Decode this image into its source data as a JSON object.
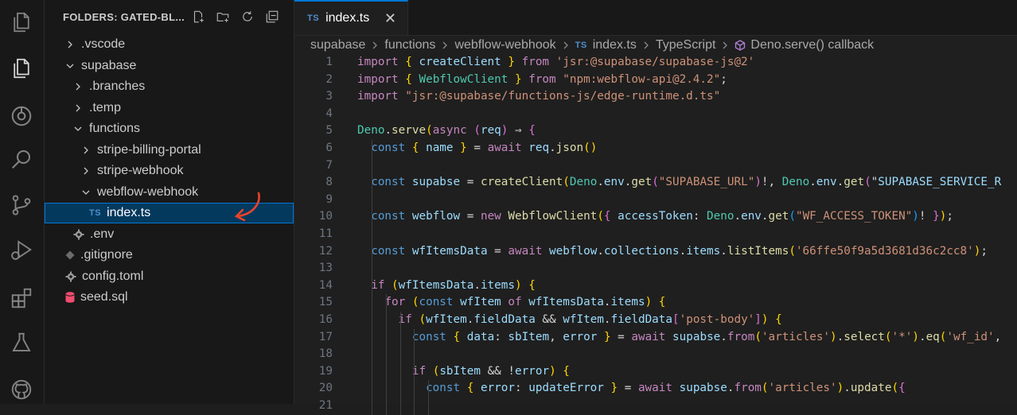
{
  "activity_bar": {
    "icons": [
      "explorer-files-icon",
      "explorer-active-icon",
      "remote-icon",
      "search-icon",
      "source-control-icon",
      "run-debug-icon",
      "extensions-icon",
      "testing-icon",
      "github-icon"
    ]
  },
  "sidebar": {
    "title": "FOLDERS: GATED-BL...",
    "tools": [
      "new-file-icon",
      "new-folder-icon",
      "refresh-icon",
      "collapse-icon"
    ],
    "tree": [
      {
        "label": ".vscode",
        "type": "folder",
        "expanded": false,
        "depth": 0
      },
      {
        "label": "supabase",
        "type": "folder",
        "expanded": true,
        "depth": 0
      },
      {
        "label": ".branches",
        "type": "folder",
        "expanded": false,
        "depth": 1
      },
      {
        "label": ".temp",
        "type": "folder",
        "expanded": false,
        "depth": 1
      },
      {
        "label": "functions",
        "type": "folder",
        "expanded": true,
        "depth": 1
      },
      {
        "label": "stripe-billing-portal",
        "type": "folder",
        "expanded": false,
        "depth": 2
      },
      {
        "label": "stripe-webhook",
        "type": "folder",
        "expanded": false,
        "depth": 2
      },
      {
        "label": "webflow-webhook",
        "type": "folder",
        "expanded": true,
        "depth": 2
      },
      {
        "label": "index.ts",
        "type": "ts",
        "depth": 3,
        "selected": true
      },
      {
        "label": ".env",
        "type": "env",
        "depth": 1
      },
      {
        "label": ".gitignore",
        "type": "git",
        "depth": 0
      },
      {
        "label": "config.toml",
        "type": "gear",
        "depth": 0
      },
      {
        "label": "seed.sql",
        "type": "db",
        "depth": 0
      }
    ]
  },
  "editor": {
    "tab": {
      "badge": "TS",
      "label": "index.ts",
      "close": "✕"
    },
    "breadcrumb": [
      "supabase",
      "functions",
      "webflow-webhook",
      "index.ts",
      "TypeScript",
      "Deno.serve() callback"
    ],
    "breadcrumb_badge": "TS",
    "line_numbers": [
      "1",
      "2",
      "3",
      "4",
      "5",
      "6",
      "7",
      "8",
      "9",
      "10",
      "11",
      "12",
      "13",
      "14",
      "15",
      "16",
      "17",
      "18",
      "19",
      "20",
      "21"
    ],
    "code": [
      "import { createClient } from 'jsr:@supabase/supabase-js@2'",
      "import { WebflowClient } from \"npm:webflow-api@2.4.2\";",
      "import \"jsr:@supabase/functions-js/edge-runtime.d.ts\"",
      "",
      "Deno.serve(async (req) ⇒ {",
      "  const { name } = await req.json()",
      "",
      "  const supabse = createClient(Deno.env.get(\"SUPABASE_URL\")!, Deno.env.get(\"SUPABASE_SERVICE_R",
      "",
      "  const webflow = new WebflowClient({ accessToken: Deno.env.get(\"WF_ACCESS_TOKEN\")! });",
      "",
      "  const wfItemsData = await webflow.collections.items.listItems('66ffe50f9a5d3681d36c2cc8');",
      "",
      "  if (wfItemsData.items) {",
      "    for (const wfItem of wfItemsData.items) {",
      "      if (wfItem.fieldData && wfItem.fieldData['post-body']) {",
      "        const { data: sbItem, error } = await supabse.from('articles').select('*').eq('wf_id',",
      "",
      "        if (sbItem && !error) {",
      "          const { error: updateError } = await supabse.from('articles').update({",
      ""
    ]
  },
  "colors": {
    "accent": "#0078d4",
    "annotation_arrow": "#e8432c",
    "ts_badge": "#4f8fcf"
  }
}
